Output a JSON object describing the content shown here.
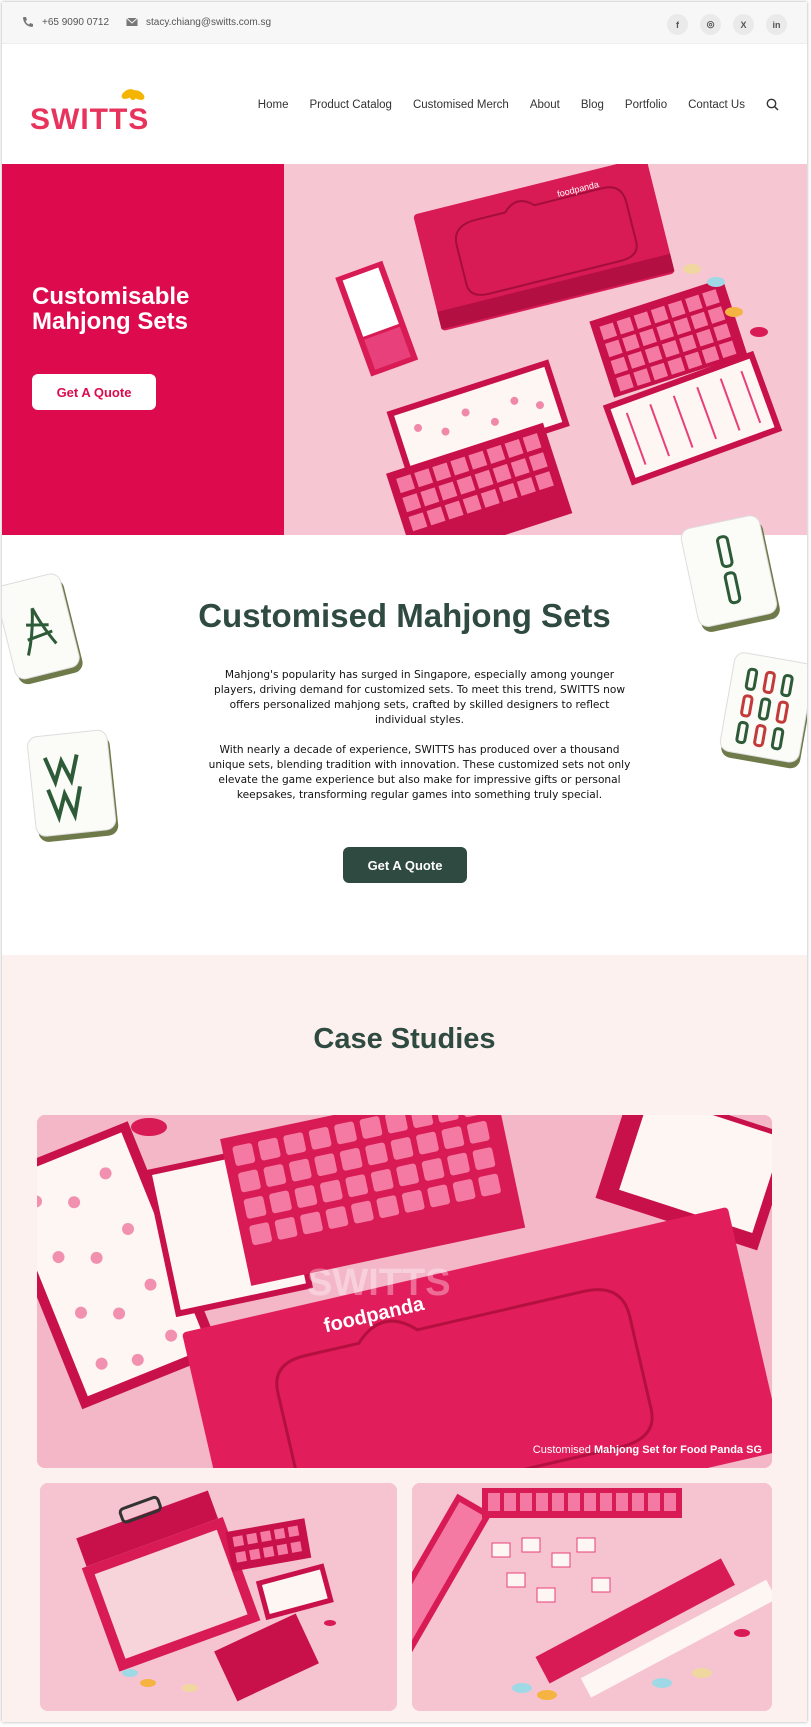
{
  "topbar": {
    "phone": "+65 9090 0712",
    "email": "stacy.chiang@switts.com.sg",
    "socials": [
      "f",
      "◎",
      "X",
      "in"
    ]
  },
  "header": {
    "logo_text": "SWITTS",
    "nav": [
      "Home",
      "Product Catalog",
      "Customised Merch",
      "About",
      "Blog",
      "Portfolio",
      "Contact Us"
    ]
  },
  "hero": {
    "title": "Customisable Mahjong Sets",
    "cta": "Get A Quote",
    "box_brand": "foodpanda"
  },
  "intro": {
    "title": "Customised Mahjong Sets",
    "paragraph1": "Mahjong's popularity has surged in Singapore, especially among younger players, driving demand for customized sets. To meet this trend, SWITTS now offers personalized mahjong sets, crafted by skilled designers to reflect individual styles.",
    "paragraph2": "With nearly a decade of experience, SWITTS has produced over a thousand unique sets, blending tradition with innovation. These customized sets not only elevate the game experience but also make for impressive gifts or personal keepsakes, transforming regular games into something truly special.",
    "cta": "Get A Quote"
  },
  "cases": {
    "title": "Case Studies",
    "main_caption_prefix": "Customised",
    "main_caption_bold": "Mahjong Set for Food Panda SG",
    "watermark": "SWITTS",
    "box_brand": "foodpanda"
  },
  "colors": {
    "brand_pink": "#dd0b4d",
    "dark_green": "#2f4a40",
    "hero_bg": "#f6c6d3",
    "cases_bg": "#fcf1ef"
  }
}
